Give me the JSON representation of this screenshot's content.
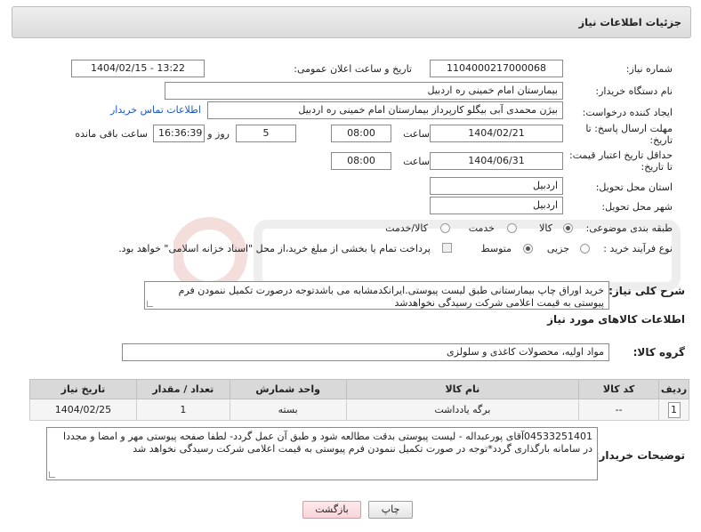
{
  "panel": {
    "title": "جزئیات اطلاعات نیاز"
  },
  "fields": {
    "need_number_label": "شماره نیاز:",
    "need_number": "1104000217000068",
    "announce_label": "تاریخ و ساعت اعلان عمومی:",
    "announce_value": "1404/02/15 - 13:22",
    "buyer_org_label": "نام دستگاه خریدار:",
    "buyer_org": "بیمارستان امام خمینی  ره  اردبیل",
    "creator_label": "ایجاد کننده درخواست:",
    "creator": "بیژن محمدی آبی بیگلو کارپرداز بیمارستان امام خمینی  ره  اردبیل",
    "contact_link": "اطلاعات تماس خریدار",
    "deadline_label_1": "مهلت ارسال پاسخ: تا",
    "deadline_label_2": "تاریخ:",
    "deadline_date": "1404/02/21",
    "hour_label": "ساعت",
    "deadline_time": "08:00",
    "days_value": "5",
    "days_label": "روز و",
    "remaining_time": "16:36:39",
    "remaining_label": "ساعت باقی مانده",
    "validity_label_1": "حداقل تاریخ اعتبار قیمت:",
    "validity_label_2": "تا تاریخ:",
    "validity_date": "1404/06/31",
    "validity_time": "08:00",
    "province_label": "استان محل تحویل:",
    "province": "اردبیل",
    "city_label": "شهر محل تحویل:",
    "city": "اردبیل",
    "category_label": "طبقه بندی موضوعی:",
    "category_goods": "کالا",
    "category_service": "خدمت",
    "category_both": "کالا/خدمت",
    "process_label": "نوع فرآیند خرید :",
    "process_minor": "جزیی",
    "process_medium": "متوسط",
    "payment_note": "پرداخت تمام یا بخشی از مبلغ خرید،از محل \"اسناد خزانه اسلامی\" خواهد بود."
  },
  "description": {
    "label": "شرح کلی نیاز:",
    "text": "خرید اوراق چاپ بیمارستانی طبق لیست پیوستی.ایرانکدمشابه می باشدتوجه درصورت تکمیل ننمودن فرم پیوستی به قیمت اعلامی شرکت رسیدگی نخواهدشد"
  },
  "goods_info": {
    "section_title": "اطلاعات کالاهای مورد نیاز",
    "group_label": "گروه کالا:",
    "group_value": "مواد اولیه، محصولات کاغذی و سلولزی"
  },
  "table": {
    "headers": [
      "ردیف",
      "کد کالا",
      "نام کالا",
      "واحد شمارش",
      "تعداد / مقدار",
      "تاریخ نیاز"
    ],
    "rows": [
      {
        "row": "1",
        "code": "--",
        "name": "برگه یادداشت",
        "unit": "بسته",
        "qty": "1",
        "date": "1404/02/25"
      }
    ]
  },
  "buyer_notes": {
    "label": "توضیحات خریدار:",
    "text": "04533251401آقای پورعبداله - لیست پیوستی بدقت مطالعه شود و طبق آن عمل گردد- لطفا صفحه پیوستی مهر و امضا و مجددا در سامانه بارگذاری گردد*توجه در صورت تکمیل ننمودن فرم پیوستی به قیمت اعلامی شرکت رسیدگی نخواهد شد"
  },
  "buttons": {
    "print": "چاپ",
    "back": "بازگشت"
  },
  "colors": {
    "link": "#1a56c4",
    "back_button": "#f8d5da",
    "watermark": "#c0392b"
  }
}
